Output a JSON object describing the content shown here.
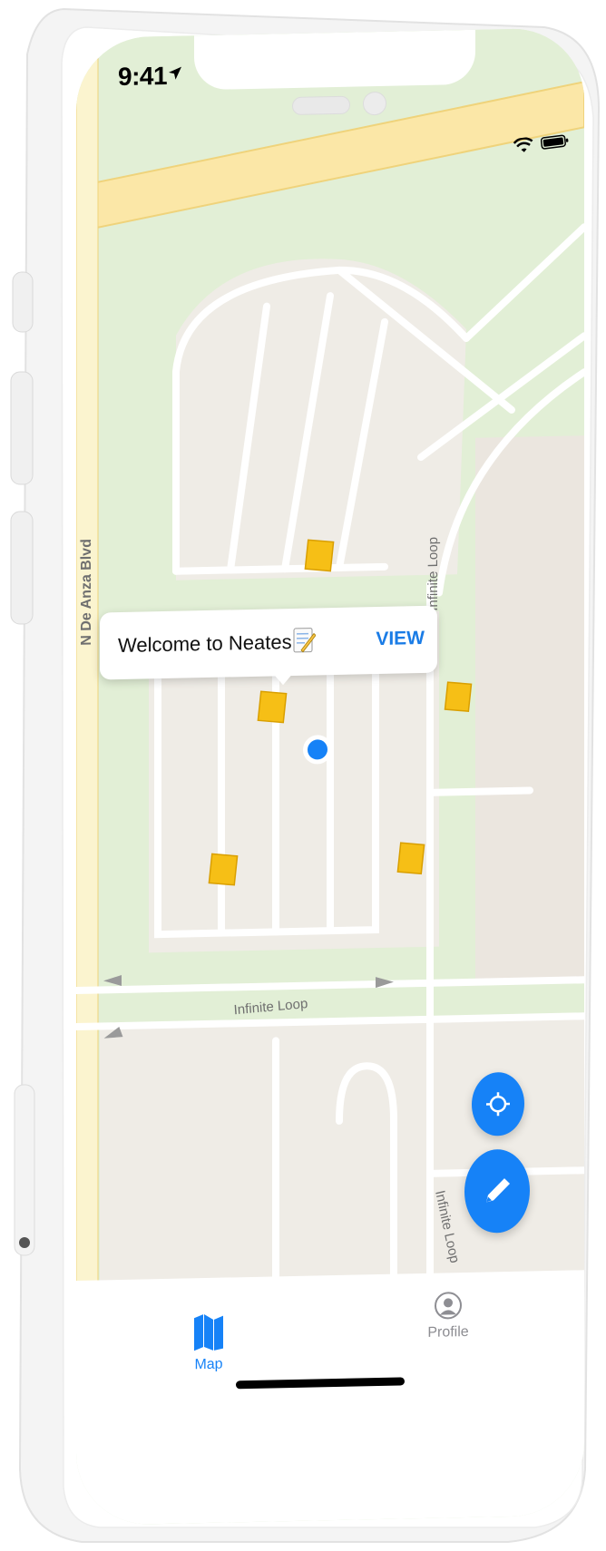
{
  "status_bar": {
    "time": "9:41",
    "icons": [
      "location-arrow-icon",
      "wifi-icon",
      "battery-icon"
    ]
  },
  "map": {
    "roads": [
      "N De Anza Blvd",
      "Infinite Loop",
      "Infinite Loop",
      "Infinite Loop"
    ],
    "callout": {
      "text": "Welcome to Neates!",
      "emoji": "memo-icon",
      "action": "VIEW"
    }
  },
  "buttons": {
    "locate": "locate-icon",
    "compose": "pencil-icon"
  },
  "tab_bar": {
    "tabs": [
      {
        "label": "Map",
        "icon": "map-icon",
        "active": true
      },
      {
        "label": "Profile",
        "icon": "profile-icon",
        "active": false
      }
    ]
  },
  "colors": {
    "accent": "#1682f7",
    "note_marker": "#f6bf16",
    "park": "#e2efd6",
    "road_major": "#fbe7a7"
  }
}
